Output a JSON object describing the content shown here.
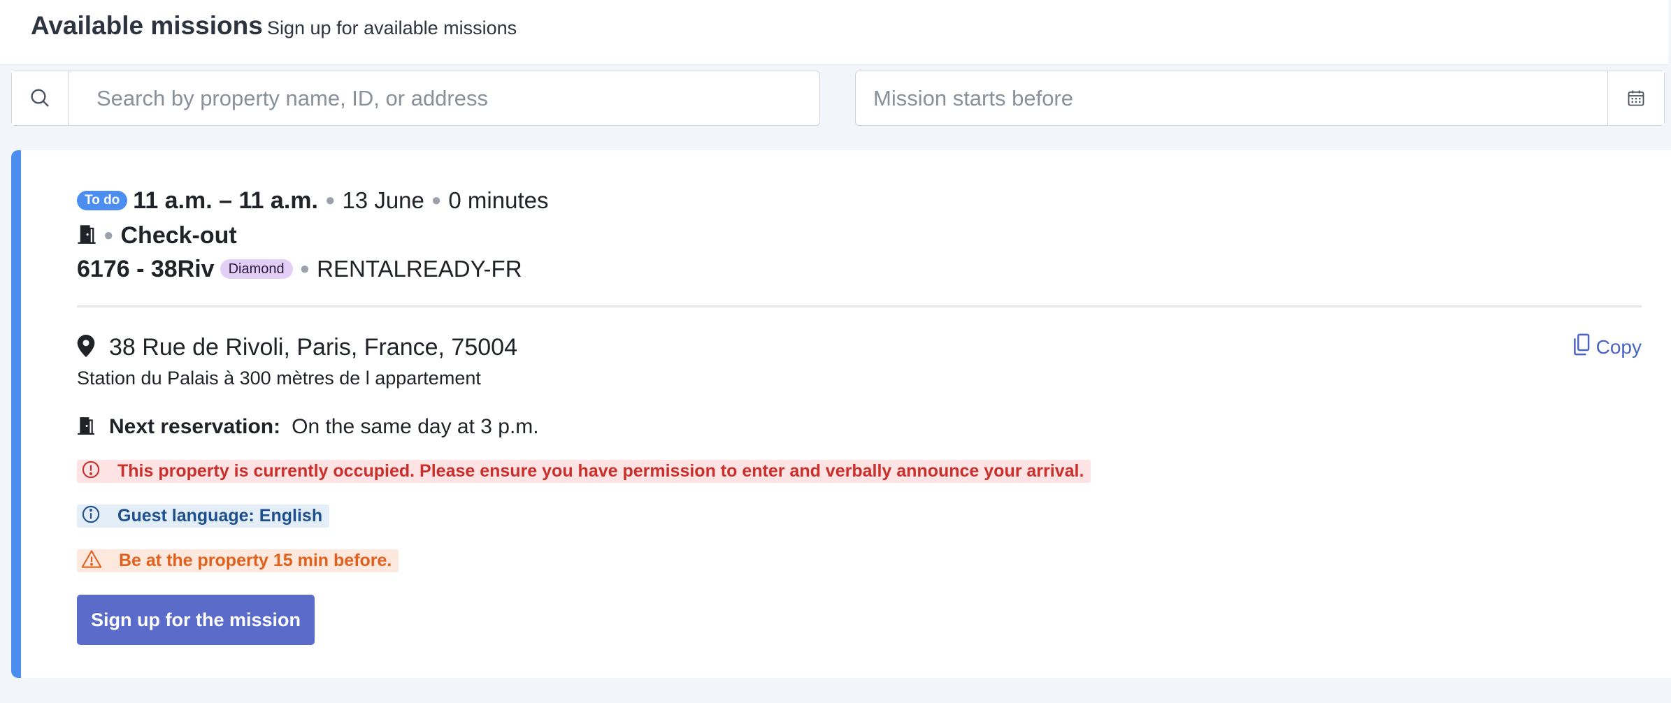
{
  "header": {
    "title": "Available missions",
    "subtitle": "Sign up for available missions"
  },
  "filters": {
    "search_placeholder": "Search by property name, ID, or address",
    "date_placeholder": "Mission starts before"
  },
  "mission": {
    "status_badge": "To do",
    "time_range": "11 a.m. – 11 a.m.",
    "date": "13 June",
    "duration": "0 minutes",
    "type": "Check-out",
    "property_name": "6176 - 38Riv",
    "tier_badge": "Diamond",
    "account": "RENTALREADY-FR",
    "address": "38 Rue de Rivoli, Paris, France, 75004",
    "copy_label": "Copy",
    "address_note": "Station du Palais à 300 mètres de l appartement",
    "next_reservation_label": "Next reservation:",
    "next_reservation_value": "On the same day at 3 p.m.",
    "alerts": {
      "occupied": "This property is currently occupied. Please ensure you have permission to enter and verbally announce your arrival.",
      "language": "Guest language: English",
      "early": "Be at the property 15 min before."
    },
    "signup_label": "Sign up for the mission"
  },
  "icons": {
    "search": "search-icon",
    "calendar": "calendar-icon",
    "door": "door-icon",
    "location": "location-pin-icon",
    "copy": "copy-icon",
    "error": "alert-circle-icon",
    "info": "info-icon",
    "warning": "warning-icon"
  },
  "colors": {
    "accent": "#4c8ef0",
    "primary_button": "#5b6bc9",
    "error": "#c9302c",
    "info": "#1d4f8c",
    "warning": "#e0601e",
    "tier_badge": "#e3cff5"
  }
}
